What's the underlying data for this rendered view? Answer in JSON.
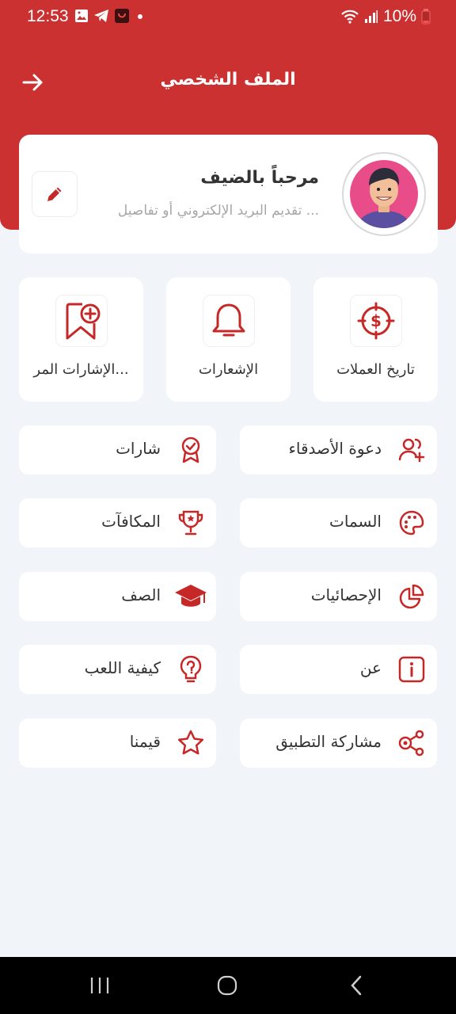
{
  "status_bar": {
    "time": "12:53",
    "battery": "10%"
  },
  "header": {
    "title": "الملف الشخصي"
  },
  "profile": {
    "greeting": "مرحباً بالضيف",
    "subtitle": "تقديم البريد الإلكتروني أو تفاصيل ..."
  },
  "tiles": [
    {
      "label": "تاريخ العملات",
      "icon": "coin-history-icon"
    },
    {
      "label": "الإشعارات",
      "icon": "bell-icon"
    },
    {
      "label": "الإشارات المر...",
      "icon": "bookmark-add-icon"
    }
  ],
  "menu": {
    "invite": "دعوة الأصدقاء",
    "badges": "شارات",
    "themes": "السمات",
    "rewards": "المكافآت",
    "stats": "الإحصائيات",
    "class": "الصف",
    "about": "عن",
    "how_to_play": "كيفية اللعب",
    "share_app": "مشاركة التطبيق",
    "rate_us": "قيمنا"
  },
  "colors": {
    "accent": "#cc3131",
    "background": "#f1f4f8"
  }
}
